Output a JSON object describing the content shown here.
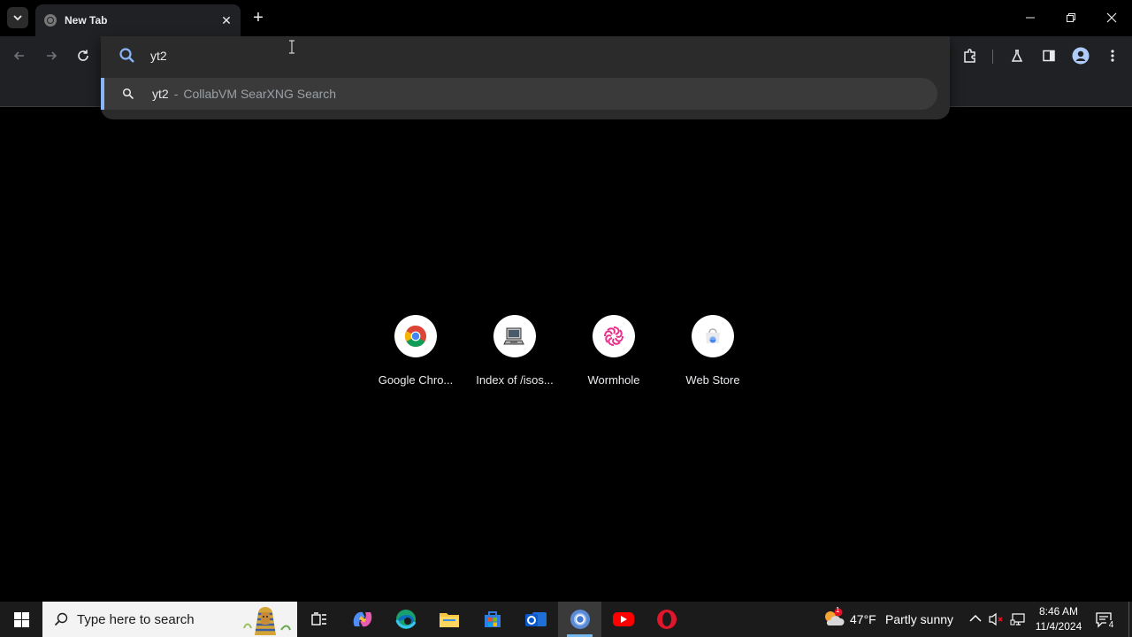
{
  "browser": {
    "tab_title": "New Tab",
    "new_tab_glyph": "+",
    "close_glyph": "✕"
  },
  "omnibox": {
    "query": "yt2",
    "suggestion": {
      "query": "yt2",
      "separator": "-",
      "engine": "CollabVM SearXNG Search"
    }
  },
  "shortcuts": [
    {
      "label": "Google Chro...",
      "icon": "chrome-icon"
    },
    {
      "label": "Index of /isos...",
      "icon": "computer-icon"
    },
    {
      "label": "Wormhole",
      "icon": "wormhole-icon"
    },
    {
      "label": "Web Store",
      "icon": "web-store-icon"
    }
  ],
  "taskbar": {
    "search_placeholder": "Type here to search",
    "weather_temp": "47°F",
    "weather_text": "Partly sunny",
    "weather_badge": "1",
    "time": "8:46 AM",
    "date": "11/4/2024",
    "notification_count": "4"
  },
  "colors": {
    "accent": "#8ab4f8",
    "toolbar": "#202124",
    "omnibox": "#2b2b2b"
  }
}
